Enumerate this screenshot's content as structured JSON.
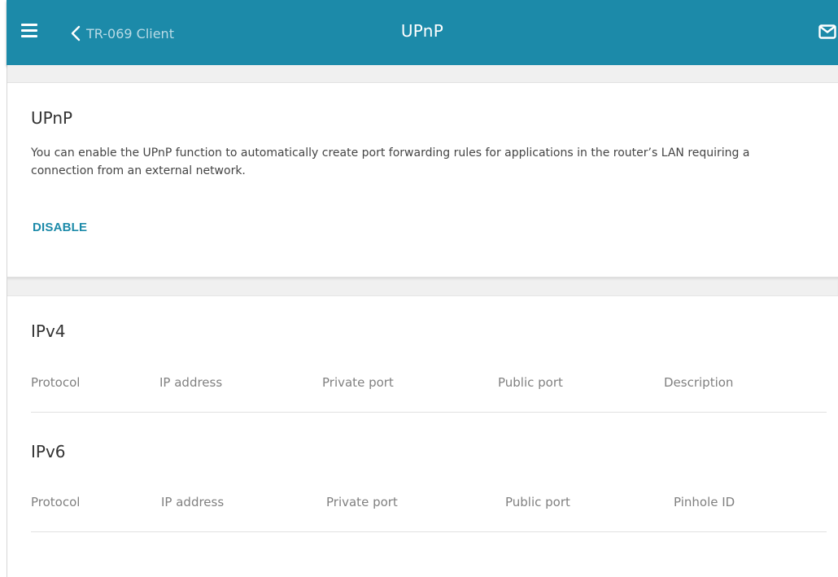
{
  "header": {
    "back_label": "TR-069 Client",
    "title": "UPnP",
    "icons": {
      "menu": "hamburger-menu-icon",
      "back": "chevron-left-icon",
      "notifications": "envelope-icon"
    },
    "background_color": "#1c8aa9"
  },
  "upnp_section": {
    "title": "UPnP",
    "description": "You can enable the UPnP function to automatically create port forwarding rules for applications in the router’s LAN requiring a connection from an external network.",
    "toggle_button_label": "DISABLE"
  },
  "ipv4_section": {
    "title": "IPv4",
    "columns": [
      "Protocol",
      "IP address",
      "Private port",
      "Public port",
      "Description"
    ],
    "rows": []
  },
  "ipv6_section": {
    "title": "IPv6",
    "columns": [
      "Protocol",
      "IP address",
      "Private port",
      "Public port",
      "Pinhole ID"
    ],
    "rows": []
  },
  "colors": {
    "accent": "#1c8aa9",
    "section_band": "#f0f0f0"
  }
}
